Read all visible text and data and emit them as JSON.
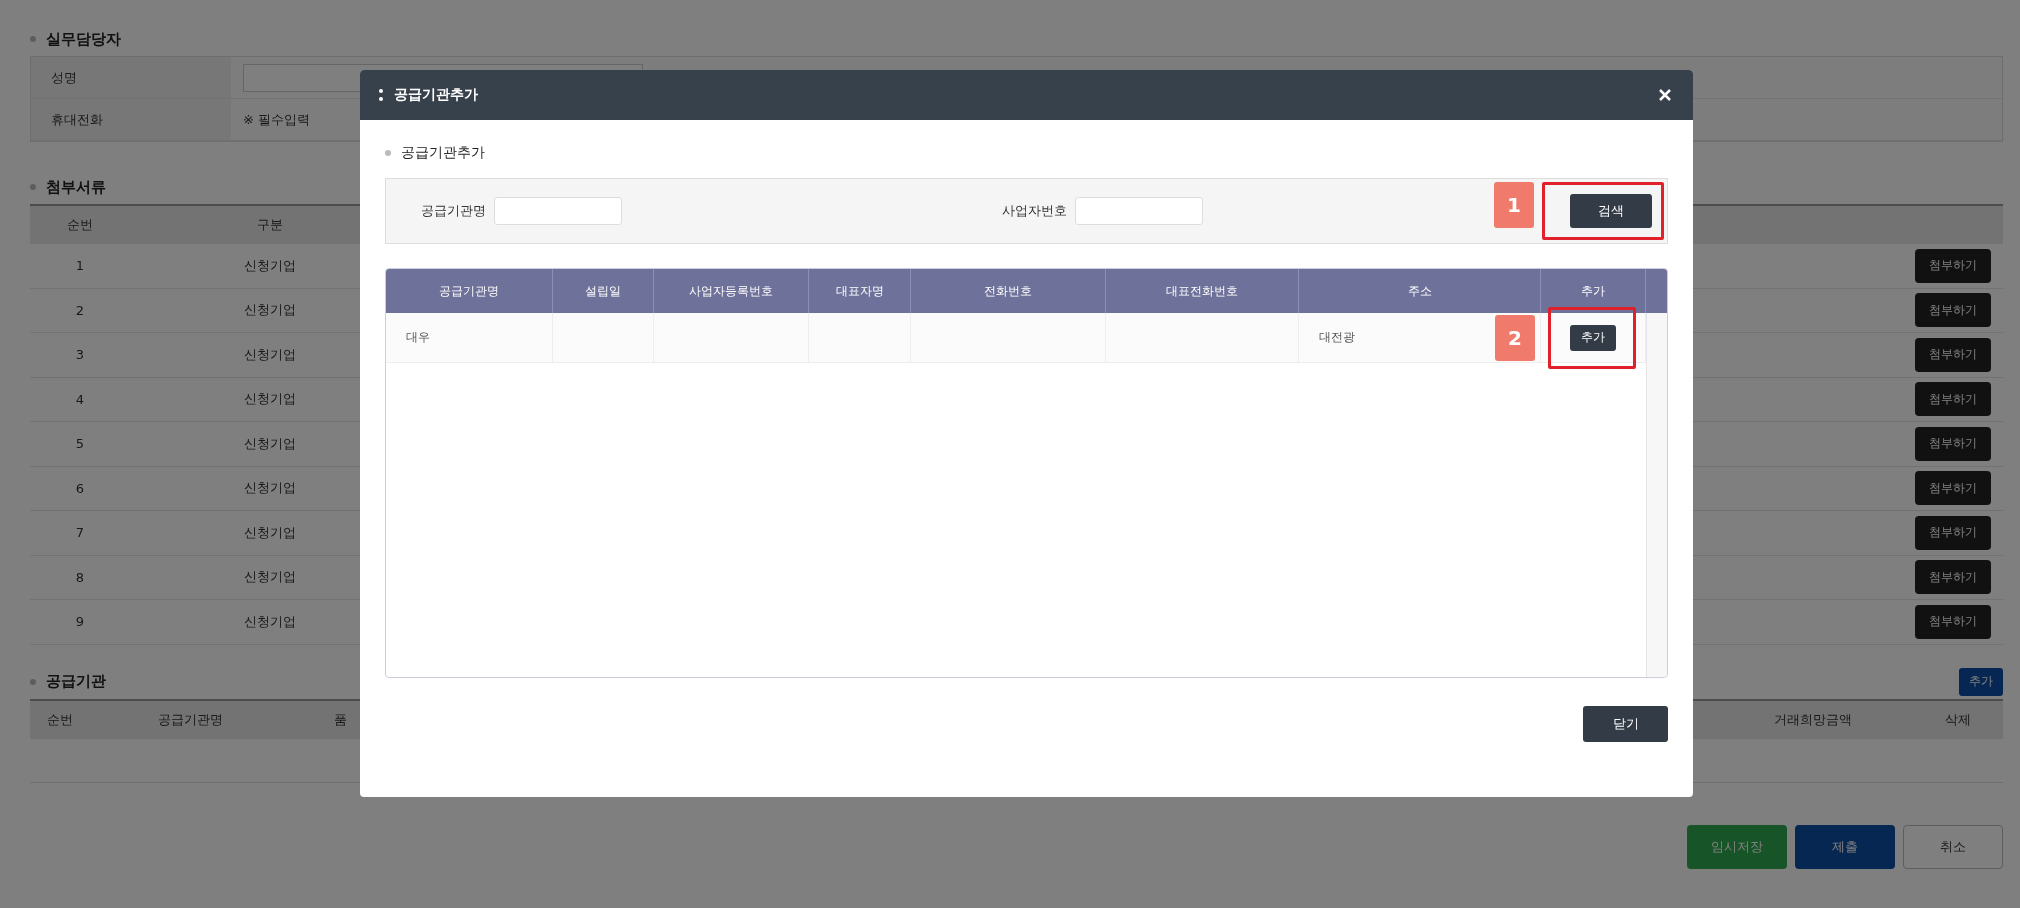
{
  "background": {
    "staff_section": {
      "title": "실무담당자",
      "fields": [
        {
          "label": "성명"
        },
        {
          "label": "휴대전화",
          "value": "※ 필수입력"
        }
      ]
    },
    "attachments": {
      "title": "첨부서류",
      "columns": [
        "순번",
        "구분"
      ],
      "rows": [
        {
          "no": "1",
          "type": "신청기업",
          "action": "첨부하기"
        },
        {
          "no": "2",
          "type": "신청기업",
          "action": "첨부하기"
        },
        {
          "no": "3",
          "type": "신청기업",
          "action": "첨부하기"
        },
        {
          "no": "4",
          "type": "신청기업",
          "action": "첨부하기"
        },
        {
          "no": "5",
          "type": "신청기업",
          "action": "첨부하기"
        },
        {
          "no": "6",
          "type": "신청기업",
          "action": "첨부하기"
        },
        {
          "no": "7",
          "type": "신청기업",
          "action": "첨부하기"
        },
        {
          "no": "8",
          "type": "신청기업",
          "action": "첨부하기"
        },
        {
          "no": "9",
          "type": "신청기업",
          "action": "첨부하기"
        }
      ]
    },
    "suppliers": {
      "title": "공급기관",
      "add_button": "추가",
      "columns_left": [
        "순번",
        "공급기관명",
        "품"
      ],
      "columns_right": [
        "거래희망금액",
        "삭제"
      ]
    },
    "actions": [
      {
        "label": "임시저장",
        "kind": "save"
      },
      {
        "label": "제출",
        "kind": "submit"
      },
      {
        "label": "취소",
        "kind": "cancel"
      }
    ]
  },
  "dialog": {
    "title": "공급기관추가",
    "section_title": "공급기관추가",
    "search": {
      "fields": [
        {
          "label": "공급기관명"
        },
        {
          "label": "사업자번호"
        }
      ],
      "button": "검색",
      "step_badge": "1"
    },
    "table": {
      "columns": [
        "공급기관명",
        "설립일",
        "사업자등록번호",
        "대표자명",
        "전화번호",
        "대표전화번호",
        "주소",
        "추가"
      ],
      "rows": [
        {
          "name": "대우",
          "address": "대전광",
          "action": "추가",
          "step_badge": "2"
        }
      ]
    },
    "close_button": "닫기"
  }
}
